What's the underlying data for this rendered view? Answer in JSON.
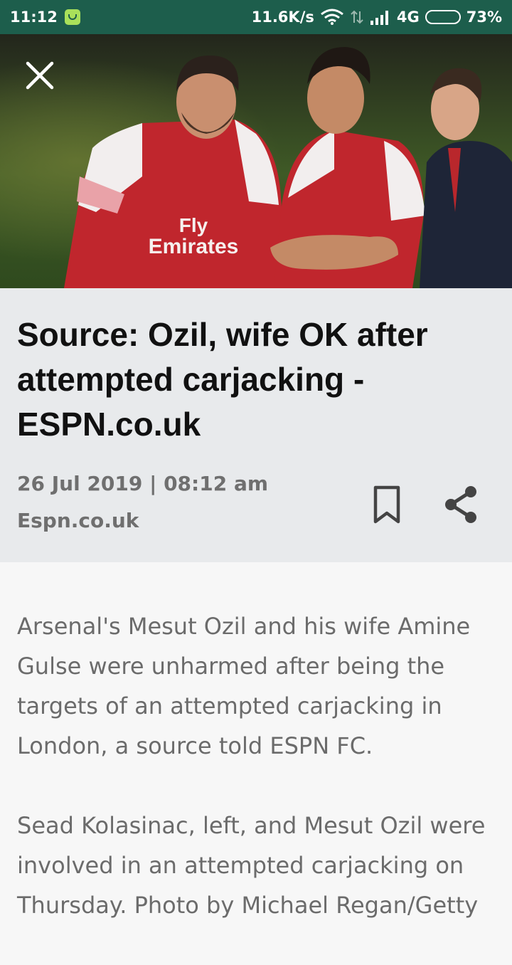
{
  "status_bar": {
    "time": "11:12",
    "network_speed": "11.6K/s",
    "network_type": "4G",
    "battery_percent": "73%",
    "battery_level": 0.73,
    "icons": [
      "app-notification-icon",
      "wifi-icon",
      "data-arrows-icon",
      "signal-icon",
      "battery-icon"
    ]
  },
  "hero": {
    "description_icon": "article-photo",
    "close_icon": "close-icon"
  },
  "article": {
    "headline": "Source: Ozil, wife OK after attempted carjacking - ESPN.co.uk",
    "date_time": "26 Jul 2019 | 08:12 am",
    "source": "Espn.co.uk",
    "paragraphs": [
      "Arsenal's Mesut Ozil and his wife Amine Gulse were unharmed after being the targets of an attempted carjacking in London, a source told ESPN FC.",
      "Sead Kolasinac, left, and Mesut Ozil were involved in an attempted carjacking on Thursday. Photo by Michael Regan/Getty"
    ]
  },
  "actions": {
    "bookmark_icon": "bookmark-icon",
    "share_icon": "share-icon"
  },
  "colors": {
    "status_bar_bg": "#1d5e4c",
    "header_panel_bg": "#e8eaec",
    "body_bg": "#f7f7f7",
    "headline_color": "#111111",
    "meta_color": "#6f6f6f",
    "body_text_color": "#6b6b6b"
  }
}
